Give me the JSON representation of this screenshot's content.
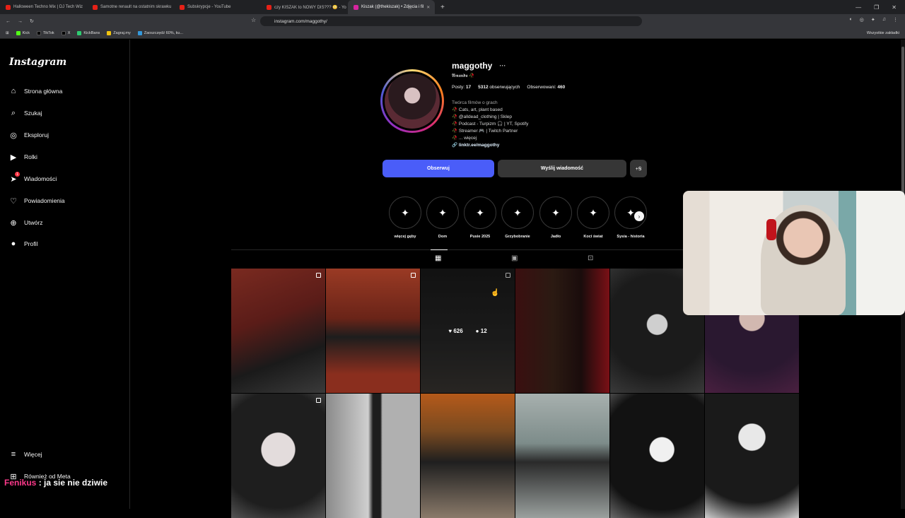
{
  "browser": {
    "tabs": [
      {
        "title": "Halloween Techno Mix | DJ Tech Wiz"
      },
      {
        "title": "Samotne renault na ostatnim skrawku"
      },
      {
        "title": "Subskrypcje - YouTube"
      },
      {
        "title": "czy KISZAK to NOWY DIS??? 😳 - Yo"
      },
      {
        "title": "Kiszak (@thekiszak) • Zdjęcia i fil"
      }
    ],
    "url": "instagram.com/maggothy/",
    "bookmarks": [
      "Kick",
      "TikTok",
      "X",
      "KickBans",
      "Zagraj.my",
      "Zaoszczędź 60%, ku..."
    ],
    "bookmarks_right": "Wszystkie zakładki"
  },
  "sidebar": {
    "logo": "Instagram",
    "items": [
      {
        "label": "Strona główna",
        "icon": "⌂"
      },
      {
        "label": "Szukaj",
        "icon": "⌕"
      },
      {
        "label": "Eksploruj",
        "icon": "◎"
      },
      {
        "label": "Rolki",
        "icon": "▶"
      },
      {
        "label": "Wiadomości",
        "icon": "➤",
        "badge": "1"
      },
      {
        "label": "Powiadomienia",
        "icon": "♡"
      },
      {
        "label": "Utwórz",
        "icon": "⊕"
      },
      {
        "label": "Profil",
        "icon": "●"
      }
    ],
    "more": {
      "label": "Więcej",
      "icon": "≡"
    },
    "meta": {
      "label": "Również od Meta",
      "icon": "⊞"
    }
  },
  "profile": {
    "username": "maggothy",
    "more_icon": "···",
    "fullname": "𝕬𝖒𝖆𝖓𝖉𝖆 🥀",
    "stats": {
      "posts_label": "Posty:",
      "posts": "17",
      "followers": "5312",
      "followers_label": "obserwujących",
      "following_label": "Obserwowani:",
      "following": "460"
    },
    "category": "Twórca filmów o grach",
    "bio_lines": [
      "🥀 Cats, art, plant based",
      "🥀 @alldead_clothing | Sklep",
      "🥀 Podcast - Turpizm 🎧 | YT, Spotify",
      "🥀 Streamer 🎮 | Twitch Partner",
      "🥀 ... więcej"
    ],
    "link": "linktr.ee/maggothy",
    "follow_button": "Obserwuj",
    "message_button": "Wyślij wiadomość",
    "add_button": "+Ꞩ"
  },
  "highlights": [
    {
      "label": "więcej gęby"
    },
    {
      "label": "Dom"
    },
    {
      "label": "Pusie 2025"
    },
    {
      "label": "Grzybobranie"
    },
    {
      "label": "Jadło"
    },
    {
      "label": "Koci świat"
    },
    {
      "label": "Sysia - historia"
    }
  ],
  "post_tabs": [
    "grid-icon",
    "reels-icon",
    "tagged-icon"
  ],
  "posts": [
    {
      "multi": true
    },
    {
      "multi": true
    },
    {
      "multi": true,
      "likes": "626",
      "comments": "12"
    },
    {
      "multi": false
    },
    {
      "multi": true
    },
    {
      "multi": false
    },
    {
      "multi": true
    },
    {
      "multi": false
    },
    {
      "multi": false
    },
    {
      "multi": false
    },
    {
      "multi": false
    },
    {
      "multi": false
    }
  ],
  "overlay_chat": {
    "nick": "Fenikus",
    "message": " : ja sie nie dziwie"
  }
}
